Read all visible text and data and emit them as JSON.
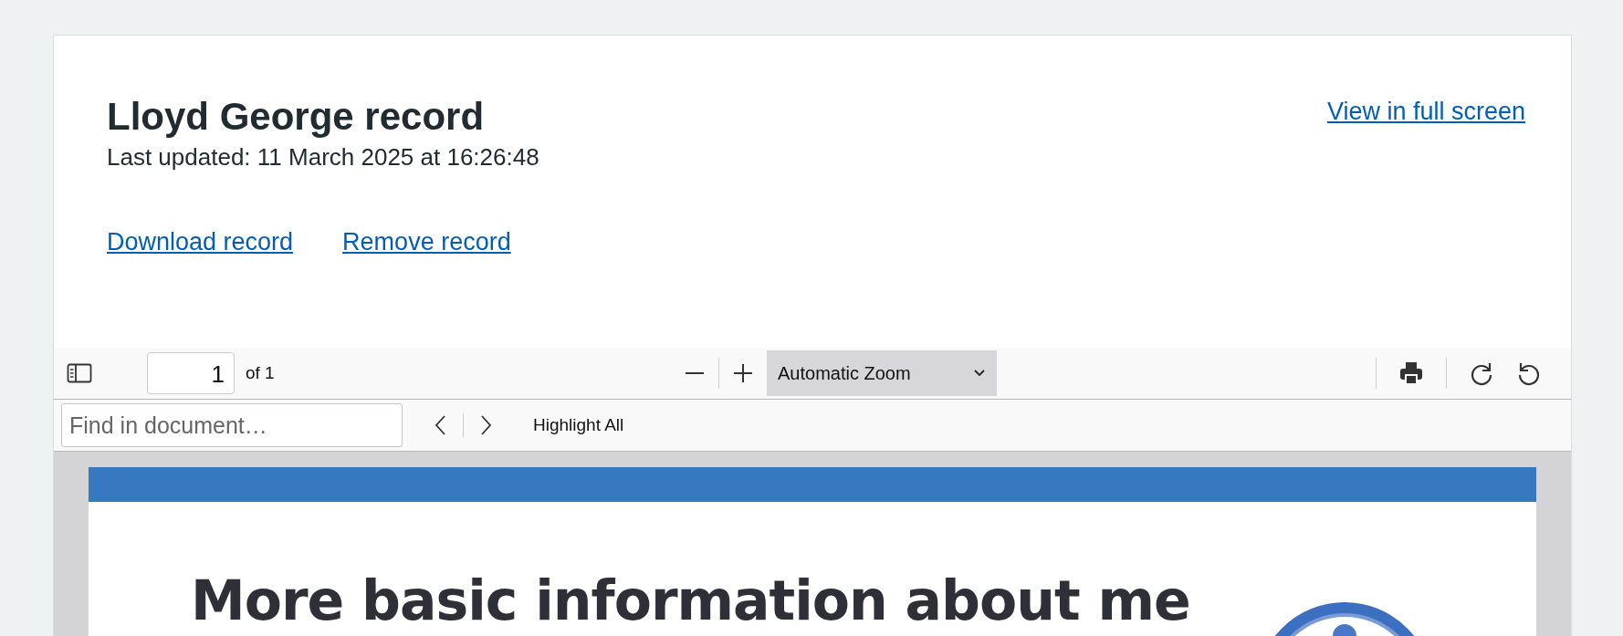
{
  "record": {
    "title": "Lloyd George record",
    "last_updated": "Last updated: 11 March 2025 at 16:26:48",
    "full_screen_link": "View in full screen",
    "actions": [
      "Download record",
      "Remove record"
    ]
  },
  "viewer_toolbar": {
    "page_number": "1",
    "page_count": "of 1",
    "zoom": "Automatic Zoom"
  },
  "find_bar": {
    "placeholder": "Find in document…",
    "highlight_all": "Highlight All"
  },
  "document": {
    "heading": "More basic information about me"
  }
}
